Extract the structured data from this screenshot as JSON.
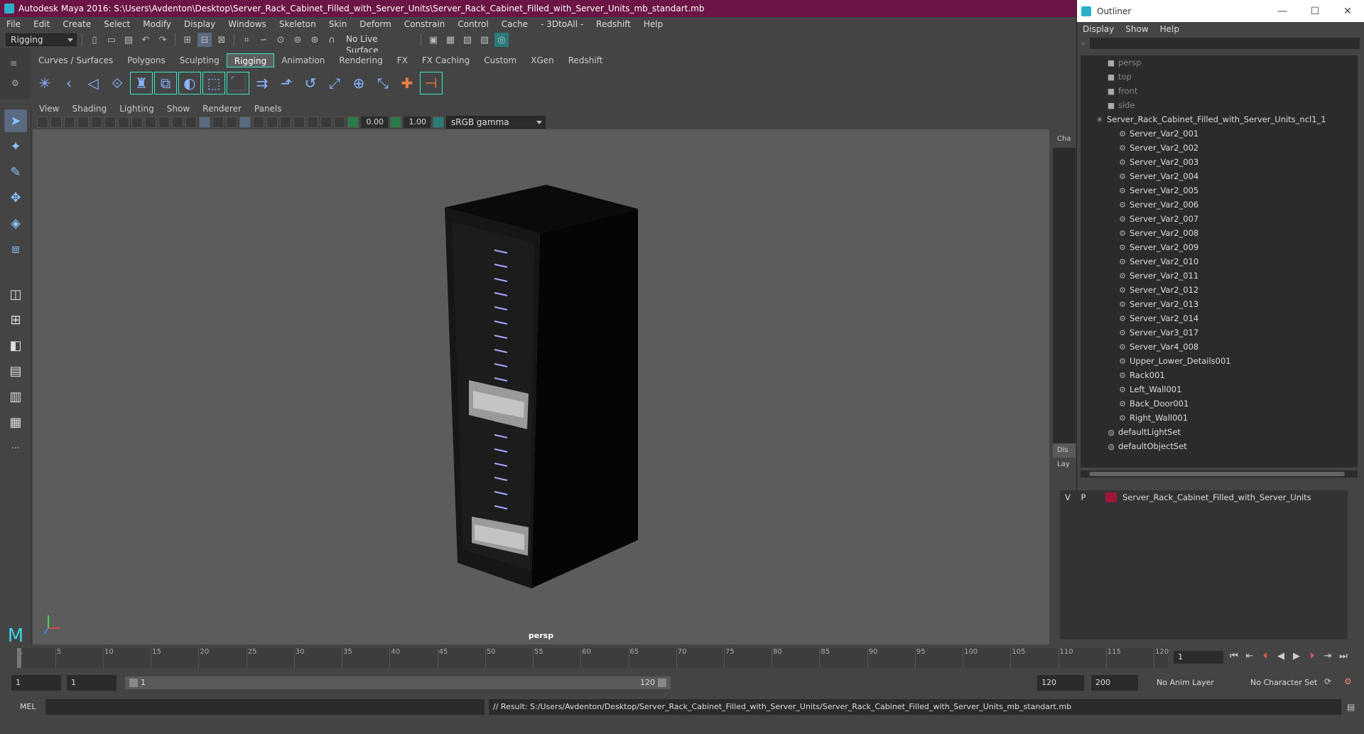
{
  "title": "Autodesk Maya 2016: S:\\Users\\Avdenton\\Desktop\\Server_Rack_Cabinet_Filled_with_Server_Units\\Server_Rack_Cabinet_Filled_with_Server_Units_mb_standart.mb",
  "menus": [
    "File",
    "Edit",
    "Create",
    "Select",
    "Modify",
    "Display",
    "Windows",
    "Skeleton",
    "Skin",
    "Deform",
    "Constrain",
    "Control",
    "Cache",
    "- 3DtoAll -",
    "Redshift",
    "Help"
  ],
  "mode_dropdown": "Rigging",
  "live_surface": "No Live Surface",
  "shelf_tabs": [
    "Curves / Surfaces",
    "Polygons",
    "Sculpting",
    "Rigging",
    "Animation",
    "Rendering",
    "FX",
    "FX Caching",
    "Custom",
    "XGen",
    "Redshift"
  ],
  "shelf_active_tab": "Rigging",
  "viewport_menus": [
    "View",
    "Shading",
    "Lighting",
    "Show",
    "Renderer",
    "Panels"
  ],
  "viewport_fields": {
    "exposure": "0.00",
    "gamma": "1.00",
    "colorspace": "sRGB gamma"
  },
  "camera_label": "persp",
  "outliner": {
    "title": "Outliner",
    "menus": [
      "Display",
      "Show",
      "Help"
    ],
    "cameras": [
      "persp",
      "top",
      "front",
      "side"
    ],
    "group": "Server_Rack_Cabinet_Filled_with_Server_Units_ncl1_1",
    "children": [
      "Server_Var2_001",
      "Server_Var2_002",
      "Server_Var2_003",
      "Server_Var2_004",
      "Server_Var2_005",
      "Server_Var2_006",
      "Server_Var2_007",
      "Server_Var2_008",
      "Server_Var2_009",
      "Server_Var2_010",
      "Server_Var2_011",
      "Server_Var2_012",
      "Server_Var2_013",
      "Server_Var2_014",
      "Server_Var3_017",
      "Server_Var4_008",
      "Upper_Lower_Details001",
      "Rack001",
      "Left_Wall001",
      "Back_Door001",
      "Right_Wall001"
    ],
    "sets": [
      "defaultLightSet",
      "defaultObjectSet"
    ]
  },
  "side_tabs": [
    "Cha",
    "Dis",
    "Lay"
  ],
  "layer": {
    "v": "V",
    "p": "P",
    "name": "Server_Rack_Cabinet_Filled_with_Server_Units",
    "color": "#a0173a"
  },
  "timeline": {
    "ticks": [
      "1",
      "5",
      "10",
      "15",
      "20",
      "25",
      "30",
      "35",
      "40",
      "45",
      "50",
      "55",
      "60",
      "65",
      "70",
      "75",
      "80",
      "85",
      "90",
      "95",
      "100",
      "105",
      "110",
      "115",
      "120"
    ],
    "current_frame": "1"
  },
  "range": {
    "start": "1",
    "start2": "1",
    "slider_start": "1",
    "slider_end": "120",
    "end": "120",
    "end2": "200",
    "anim_layer": "No Anim Layer",
    "char_set": "No Character Set"
  },
  "cmdline": {
    "label": "MEL",
    "result": "// Result: S:/Users/Avdenton/Desktop/Server_Rack_Cabinet_Filled_with_Server_Units/Server_Rack_Cabinet_Filled_with_Server_Units_mb_standart.mb"
  },
  "window_controls": {
    "minimize": "—",
    "maximize": "☐",
    "close": "✕"
  }
}
